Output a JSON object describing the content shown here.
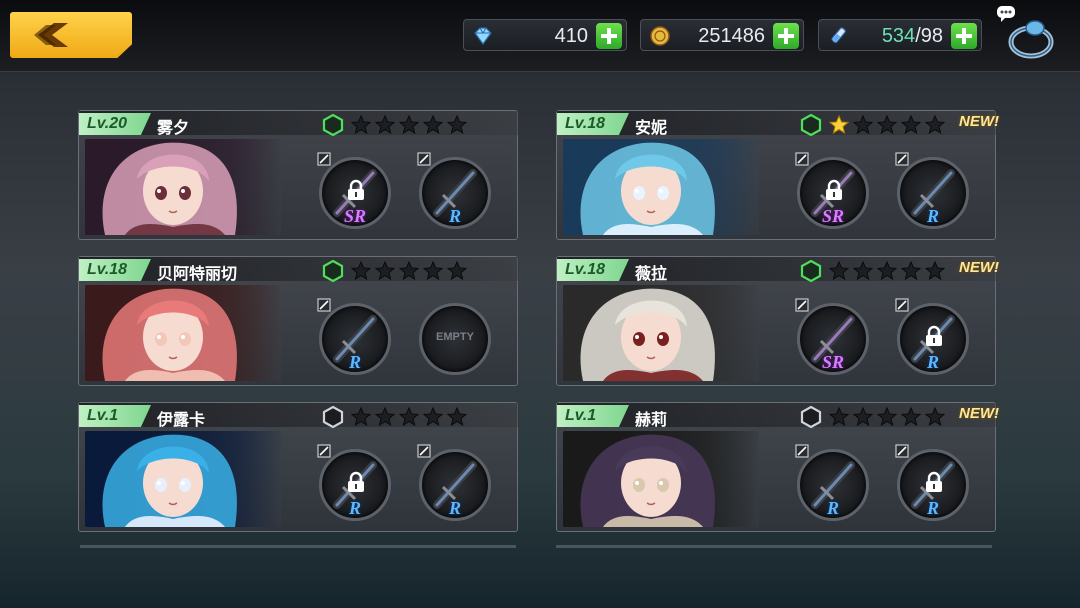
{
  "topbar": {
    "gems": {
      "icon": "gem-icon",
      "value": "410"
    },
    "gold": {
      "icon": "coin-icon",
      "value": "251486"
    },
    "stamina": {
      "icon": "vial-icon",
      "current": "534",
      "max": "/98"
    }
  },
  "characters": [
    {
      "level": "Lv.20",
      "name": "雾夕",
      "new": "",
      "stars": 0,
      "weapons": [
        {
          "rarity": "SR",
          "locked": true
        },
        {
          "rarity": "R",
          "locked": false
        }
      ],
      "palette": [
        "#2a1a2a",
        "#d9a0b8",
        "#6b2f3a"
      ]
    },
    {
      "level": "Lv.18",
      "name": "安妮",
      "new": "NEW!",
      "stars": 1,
      "weapons": [
        {
          "rarity": "SR",
          "locked": true
        },
        {
          "rarity": "R",
          "locked": false
        }
      ],
      "palette": [
        "#1a3a5a",
        "#6fc8e8",
        "#e8f4ff"
      ]
    },
    {
      "level": "Lv.18",
      "name": "贝阿特丽切",
      "new": "",
      "stars": 0,
      "weapons": [
        {
          "rarity": "R",
          "locked": false
        },
        {
          "rarity": "EMPTY",
          "locked": false
        }
      ],
      "palette": [
        "#3a1a1a",
        "#e87a7a",
        "#f4c8b8"
      ]
    },
    {
      "level": "Lv.18",
      "name": "薇拉",
      "new": "NEW!",
      "stars": 0,
      "weapons": [
        {
          "rarity": "SR",
          "locked": false
        },
        {
          "rarity": "R",
          "locked": true
        }
      ],
      "palette": [
        "#2a2a2a",
        "#e8e4dc",
        "#7a2020"
      ]
    },
    {
      "level": "Lv.1",
      "name": "伊露卡",
      "new": "",
      "stars": 0,
      "weapons": [
        {
          "rarity": "R",
          "locked": true
        },
        {
          "rarity": "R",
          "locked": false
        }
      ],
      "palette": [
        "#0a1a3a",
        "#3ab0e8",
        "#e8f0ff"
      ]
    },
    {
      "level": "Lv.1",
      "name": "赫莉",
      "new": "NEW!",
      "stars": 0,
      "weapons": [
        {
          "rarity": "R",
          "locked": false
        },
        {
          "rarity": "R",
          "locked": true
        }
      ],
      "palette": [
        "#1a1a1a",
        "#4a3a5a",
        "#d8c8b0"
      ]
    }
  ],
  "colors": {
    "accent_yellow": "#f0a915",
    "plus_green": "#3ec233",
    "sr_purple": "#d97cff",
    "r_blue": "#5cb8ff",
    "level_green": "#7ed68e"
  }
}
